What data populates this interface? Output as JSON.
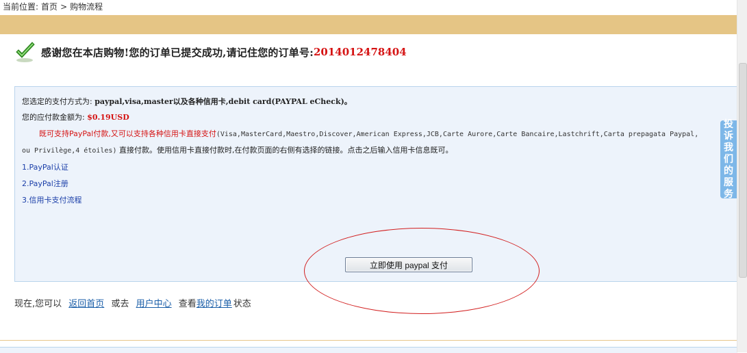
{
  "breadcrumb": {
    "label": "当前位置:",
    "home": "首页",
    "separator": ">",
    "current": "购物流程"
  },
  "thanks": {
    "message": "感谢您在本店购物!您的订单已提交成功,请记住您的订单号:",
    "order_number": "2014012478404"
  },
  "payment": {
    "method_label": "您选定的支付方式为:",
    "method_value": "paypal,visa,master以及各种信用卡,debit card(PAYPAL eCheck)。",
    "amount_label": "您的应付款金额为:",
    "amount_value": "$0.19USD",
    "support_red": "既可支持PayPal付款,又可以支持各种信用卡直接支付",
    "support_cards": "(Visa,MasterCard,Maestro,Discover,American Express,JCB,Carte Aurore,Carte Bancaire,Lastchrift,Carta prepagata Paypal,",
    "support_cards_2": "ou Privilège,4 étoiles)",
    "support_rest": "直接付款。使用信用卡直接付款时,在付款页面的右侧有选择的链接。点击之后输入信用卡信息既可。",
    "links": [
      "1.PayPal认证",
      "2.PayPal注册",
      "3.信用卡支付流程"
    ],
    "pay_button": "立即使用 paypal 支付"
  },
  "next": {
    "prefix": "现在,您可以",
    "back_home": "返回首页",
    "or_go": "或去",
    "user_center": "用户中心",
    "view": "查看",
    "my_orders": "我的订单",
    "status": "状态"
  },
  "service_tab": [
    "投",
    "诉",
    "我",
    "们",
    "的",
    "服",
    "务"
  ],
  "colors": {
    "accent_band": "#e5c585",
    "order_red": "#d51313",
    "panel_bg": "#edf3fb",
    "link_blue": "#1a5ea8",
    "service_blue": "#7db7e8"
  }
}
